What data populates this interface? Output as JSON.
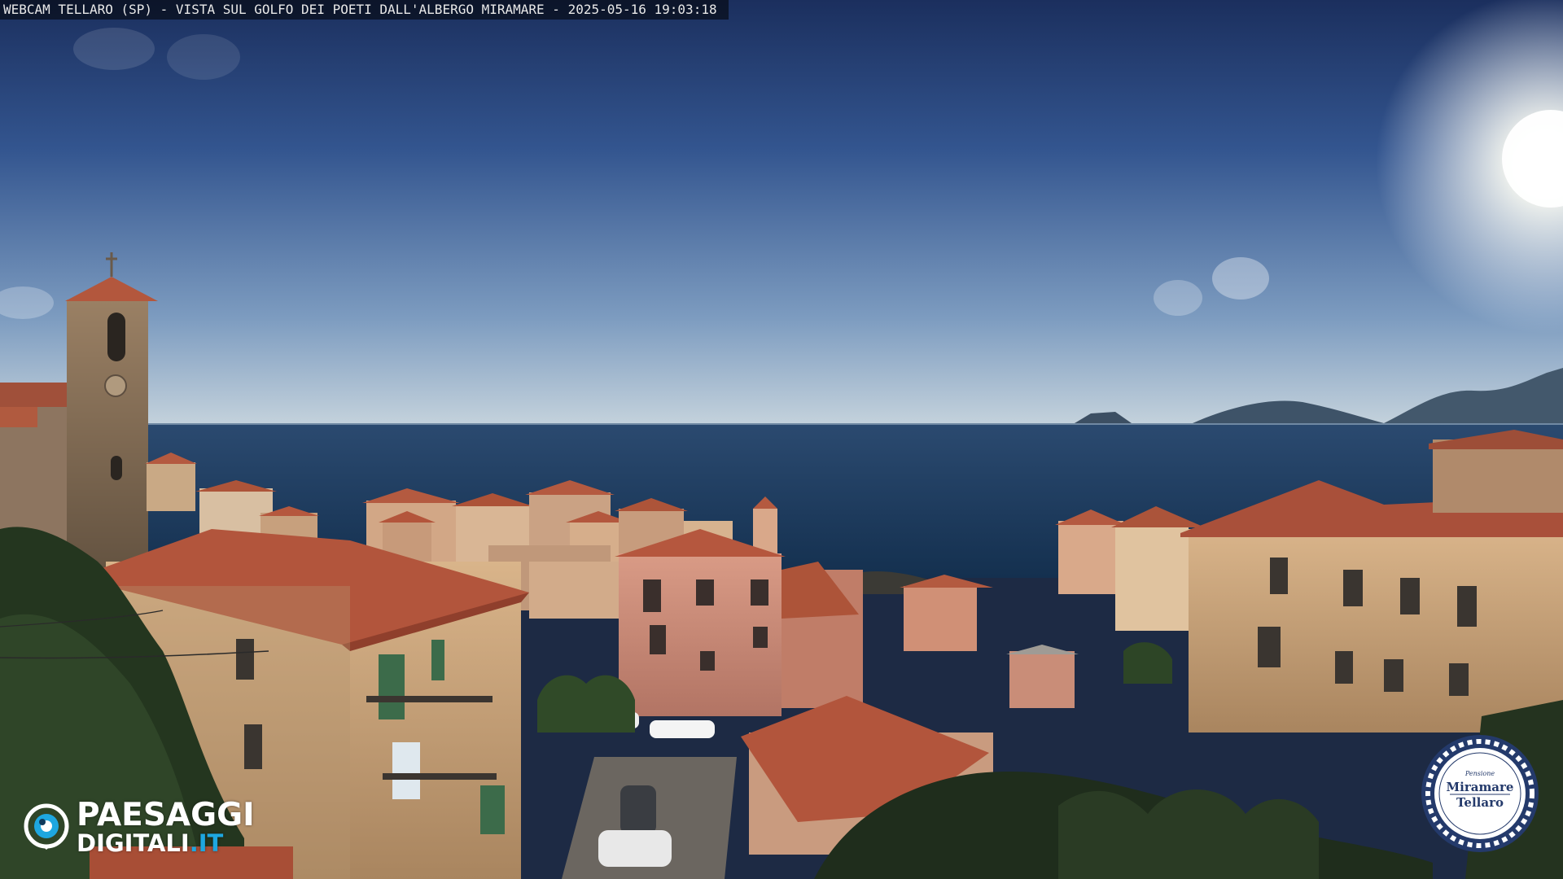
{
  "caption": "WEBCAM TELLARO (SP) - VISTA SUL GOLFO DEI POETI DALL'ALBERGO MIRAMARE - 2025-05-16 19:03:18",
  "logo_left": {
    "word1": "PAESAGGI",
    "word2_main": "DIGITALI",
    "word2_tld": ".IT",
    "icon": "eye-icon"
  },
  "logo_right": {
    "line_small": "Pensione",
    "line1": "Miramare",
    "line2": "Tellaro",
    "icon": "rope-ring-badge"
  },
  "colors": {
    "sky_top": "#213a6f",
    "sky_horizon": "#b9cbd8",
    "sea": "#1f3a5c",
    "roof": "#b5553c",
    "logo_tld": "#1ea7e0",
    "badge_blue": "#243a6b"
  }
}
